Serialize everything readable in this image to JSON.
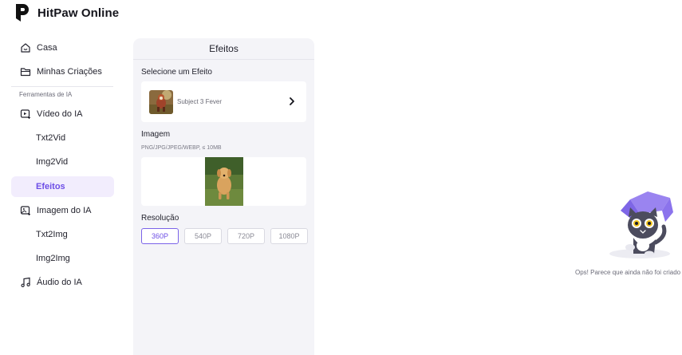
{
  "brand": {
    "name": "HitPaw Online"
  },
  "sidebar": {
    "items": [
      {
        "label": "Casa",
        "icon": "home-icon"
      },
      {
        "label": "Minhas Criações",
        "icon": "folder-icon"
      }
    ],
    "section_label": "Ferramentas de IA",
    "tools": [
      {
        "label": "Vídeo do IA",
        "icon": "video-ai-icon"
      },
      {
        "label": "Txt2Vid"
      },
      {
        "label": "Img2Vid"
      },
      {
        "label": "Efeitos",
        "active": true
      },
      {
        "label": "Imagem do IA",
        "icon": "image-ai-icon"
      },
      {
        "label": "Txt2Img"
      },
      {
        "label": "Img2Img"
      },
      {
        "label": "Áudio do IA",
        "icon": "music-icon"
      }
    ]
  },
  "panel": {
    "title": "Efeitos",
    "effect_section_label": "Selecione um Efeito",
    "effect_name": "Subject 3 Fever",
    "image_section_label": "Imagem",
    "image_hint": "PNG/JPG/JPEG/WEBP, ≤ 10MB",
    "resolution_label": "Resolução",
    "resolutions": [
      "360P",
      "540P",
      "720P",
      "1080P"
    ],
    "selected_resolution": "360P"
  },
  "empty_state": {
    "message": "Ops! Parece que ainda não foi criado"
  },
  "colors": {
    "accent": "#6d4ee6",
    "active_bg": "#f2edfd",
    "panel_bg": "#f4f4f8"
  }
}
